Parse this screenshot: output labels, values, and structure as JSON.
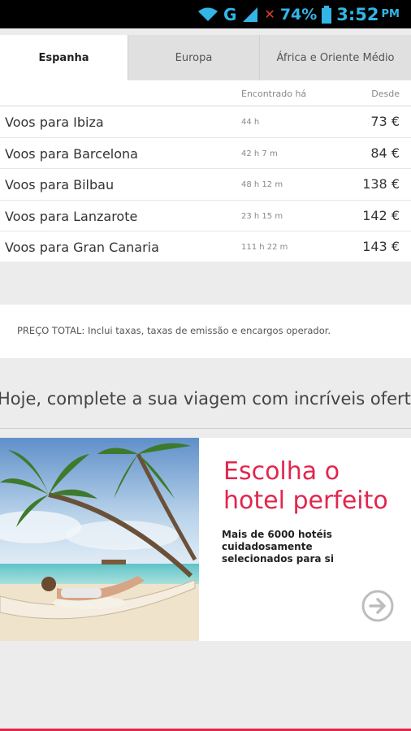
{
  "status_bar": {
    "network": "G",
    "battery_percent": "74%",
    "time": "3:52",
    "ampm": "PM"
  },
  "tabs": [
    {
      "label": "Espanha",
      "active": true
    },
    {
      "label": "Europa",
      "active": false
    },
    {
      "label": "África e Oriente Médio",
      "active": false
    }
  ],
  "flights_table": {
    "columns": {
      "found": "Encontrado há",
      "from": "Desde"
    },
    "rows": [
      {
        "destination": "Voos para Ibiza",
        "found": "44 h",
        "price": "73 €"
      },
      {
        "destination": "Voos para Barcelona",
        "found": "42 h 7 m",
        "price": "84 €"
      },
      {
        "destination": "Voos para Bilbau",
        "found": "48 h 12 m",
        "price": "138 €"
      },
      {
        "destination": "Voos para Lanzarote",
        "found": "23 h 15 m",
        "price": "142 €"
      },
      {
        "destination": "Voos para Gran Canaria",
        "found": "111 h 22 m",
        "price": "143 €"
      }
    ]
  },
  "price_note": "PREÇO TOTAL: Inclui taxas, taxas de emissão e encargos operador.",
  "offers": {
    "title": "Hoje, complete a sua viagem com incríveis ofertas",
    "hotel_card": {
      "headline": "Escolha o hotel perfeito",
      "subtitle": "Mais de 6000 hotéis cuidadosamente selecionados para si"
    }
  },
  "colors": {
    "accent": "#e2264d",
    "status_icons": "#33b5e5"
  }
}
